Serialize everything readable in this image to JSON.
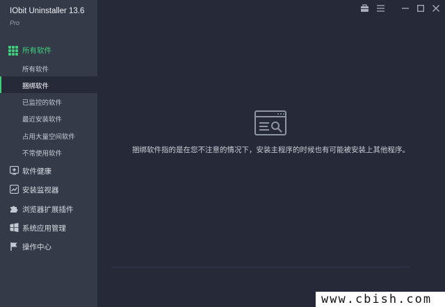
{
  "app": {
    "title": "IObit Uninstaller 13.6",
    "edition": "Pro"
  },
  "sidebar": {
    "active_category": {
      "label": "所有软件",
      "icon": "grid-icon"
    },
    "subitems": [
      {
        "label": "所有软件",
        "selected": false
      },
      {
        "label": "捆绑软件",
        "selected": true
      },
      {
        "label": "已监控的软件",
        "selected": false
      },
      {
        "label": "最近安装软件",
        "selected": false
      },
      {
        "label": "占用大量空间软件",
        "selected": false
      },
      {
        "label": "不常使用软件",
        "selected": false
      }
    ],
    "categories": [
      {
        "label": "软件健康",
        "icon": "health-plus-icon"
      },
      {
        "label": "安装监视器",
        "icon": "monitor-graph-icon"
      },
      {
        "label": "浏览器扩展插件",
        "icon": "puzzle-icon"
      },
      {
        "label": "系统应用管理",
        "icon": "windows-icon"
      },
      {
        "label": "操作中心",
        "icon": "flag-icon"
      }
    ]
  },
  "titlebar": {
    "icons": [
      "toolbox-icon",
      "menu-icon",
      "minimize-icon",
      "maximize-icon",
      "close-icon"
    ]
  },
  "main": {
    "empty_state": {
      "icon": "browser-search-icon",
      "message": "捆绑软件指的是在您不注意的情况下，安装主程序的时候也有可能被安装上其他程序。"
    }
  },
  "watermark": {
    "text": "www.cbish.com"
  },
  "colors": {
    "accent": "#3ecf7a",
    "sidebar_bg": "#343a48",
    "main_bg": "#262a38"
  }
}
